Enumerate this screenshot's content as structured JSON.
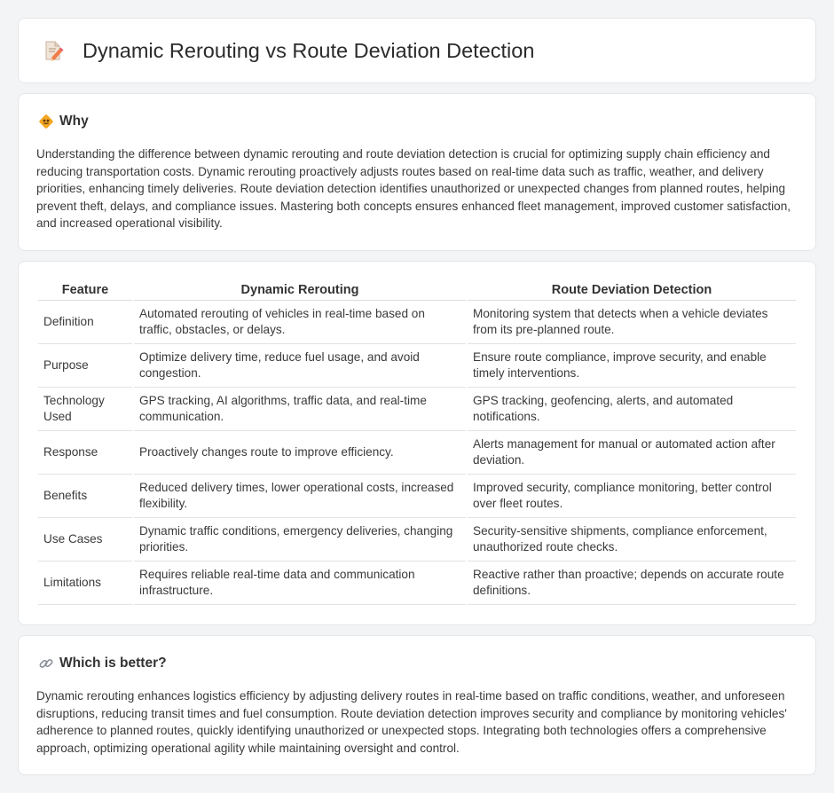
{
  "header": {
    "title": "Dynamic Rerouting vs Route Deviation Detection",
    "icon": "document-pencil-icon"
  },
  "why": {
    "icon": "diamond-sign-icon",
    "title": "Why",
    "text": "Understanding the difference between dynamic rerouting and route deviation detection is crucial for optimizing supply chain efficiency and reducing transportation costs. Dynamic rerouting proactively adjusts routes based on real-time data such as traffic, weather, and delivery priorities, enhancing timely deliveries. Route deviation detection identifies unauthorized or unexpected changes from planned routes, helping prevent theft, delays, and compliance issues. Mastering both concepts ensures enhanced fleet management, improved customer satisfaction, and increased operational visibility."
  },
  "table": {
    "headers": [
      "Feature",
      "Dynamic Rerouting",
      "Route Deviation Detection"
    ],
    "rows": [
      [
        "Definition",
        "Automated rerouting of vehicles in real-time based on traffic, obstacles, or delays.",
        "Monitoring system that detects when a vehicle deviates from its pre-planned route."
      ],
      [
        "Purpose",
        "Optimize delivery time, reduce fuel usage, and avoid congestion.",
        "Ensure route compliance, improve security, and enable timely interventions."
      ],
      [
        "Technology Used",
        "GPS tracking, AI algorithms, traffic data, and real-time communication.",
        "GPS tracking, geofencing, alerts, and automated notifications."
      ],
      [
        "Response",
        "Proactively changes route to improve efficiency.",
        "Alerts management for manual or automated action after deviation."
      ],
      [
        "Benefits",
        "Reduced delivery times, lower operational costs, increased flexibility.",
        "Improved security, compliance monitoring, better control over fleet routes."
      ],
      [
        "Use Cases",
        "Dynamic traffic conditions, emergency deliveries, changing priorities.",
        "Security-sensitive shipments, compliance enforcement, unauthorized route checks."
      ],
      [
        "Limitations",
        "Requires reliable real-time data and communication infrastructure.",
        "Reactive rather than proactive; depends on accurate route definitions."
      ]
    ]
  },
  "better": {
    "icon": "link-icon",
    "title": "Which is better?",
    "text": "Dynamic rerouting enhances logistics efficiency by adjusting delivery routes in real-time based on traffic conditions, weather, and unforeseen disruptions, reducing transit times and fuel consumption. Route deviation detection improves security and compliance by monitoring vehicles' adherence to planned routes, quickly identifying unauthorized or unexpected stops. Integrating both technologies offers a comprehensive approach, optimizing operational agility while maintaining oversight and control."
  }
}
